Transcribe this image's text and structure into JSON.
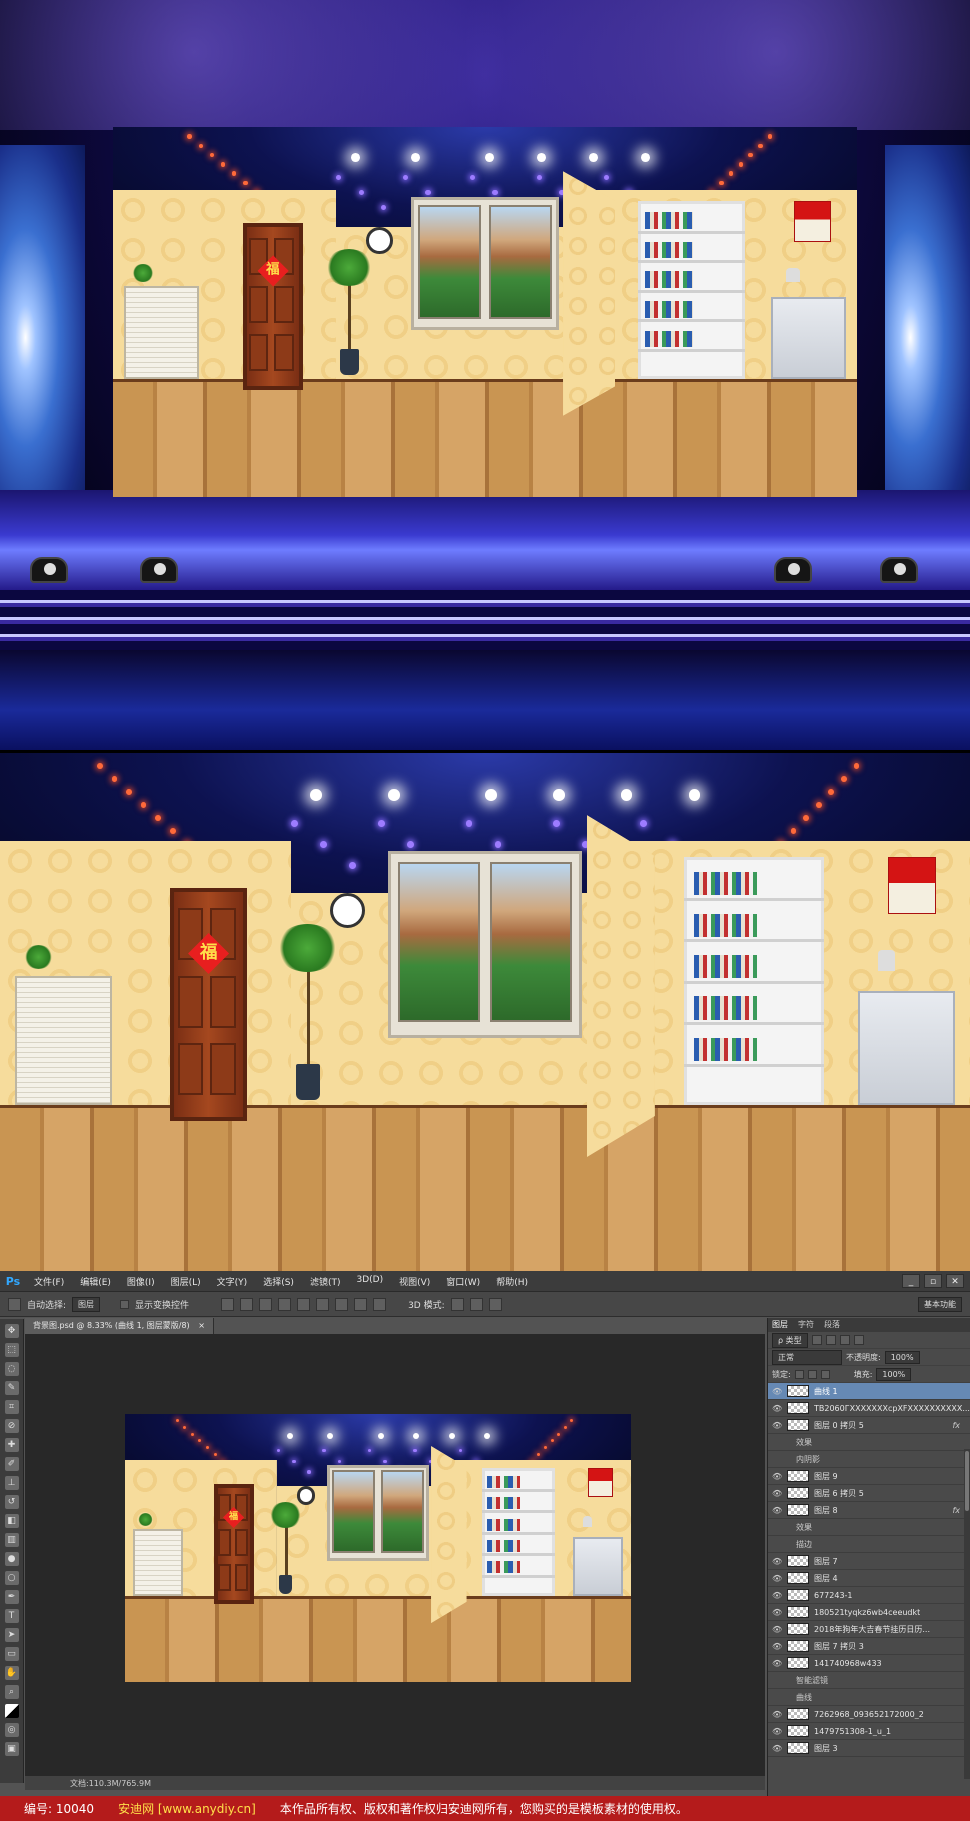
{
  "photoshop": {
    "logo": "Ps",
    "menu": [
      "文件(F)",
      "编辑(E)",
      "图像(I)",
      "图层(L)",
      "文字(Y)",
      "选择(S)",
      "滤镜(T)",
      "3D(D)",
      "视图(V)",
      "窗口(W)",
      "帮助(H)"
    ],
    "window_buttons": [
      "_",
      "▫",
      "✕"
    ],
    "options": {
      "auto_select_label": "自动选择:",
      "auto_select_value": "图层",
      "show_transform": "显示变换控件",
      "mode_3d": "3D 模式:",
      "workspace": "基本功能"
    },
    "doc_tab": "背景图.psd @ 8.33% (曲线 1, 图层蒙版/8)",
    "status": "文档:110.3M/765.9M",
    "panel_tabs": [
      "图层",
      "字符",
      "段落"
    ],
    "kind_label": "ρ 类型",
    "blend_mode": "正常",
    "opacity_label": "不透明度:",
    "opacity_value": "100%",
    "lock_label": "锁定:",
    "fill_label": "填充:",
    "fill_value": "100%",
    "layers": [
      {
        "name": "曲线 1",
        "selected": true
      },
      {
        "name": "TB2060ГXXXXXXXcpXFXXXXXXXXXX..."
      },
      {
        "name": "图层 0 拷贝 5",
        "fx": "fx"
      },
      {
        "name": "效果",
        "sub": true
      },
      {
        "name": "内阴影",
        "sub": true
      },
      {
        "name": "图层 9"
      },
      {
        "name": "图层 6 拷贝 5"
      },
      {
        "name": "图层 8",
        "fx": "fx"
      },
      {
        "name": "效果",
        "sub": true
      },
      {
        "name": "描边",
        "sub": true
      },
      {
        "name": "图层 7"
      },
      {
        "name": "图层 4"
      },
      {
        "name": "677243-1"
      },
      {
        "name": "180521tyqkz6wb4ceeudkt"
      },
      {
        "name": "2018年狗年大吉春节挂历日历..."
      },
      {
        "name": "图层 7 拷贝 3"
      },
      {
        "name": "141740968w433"
      },
      {
        "name": "智能滤镜",
        "sub": true
      },
      {
        "name": "曲线",
        "sub": true
      },
      {
        "name": "7262968_093652172000_2"
      },
      {
        "name": "1479751308-1_u_1"
      },
      {
        "name": "图层 3"
      }
    ]
  },
  "door_char": "福",
  "footer": {
    "id_label": "编号:",
    "id_value": "10040",
    "site": "安迪网 [www.anydiy.cn]",
    "notice": "本作品所有权、版权和著作权归安迪网所有，您购买的是模板素材的使用权。"
  }
}
